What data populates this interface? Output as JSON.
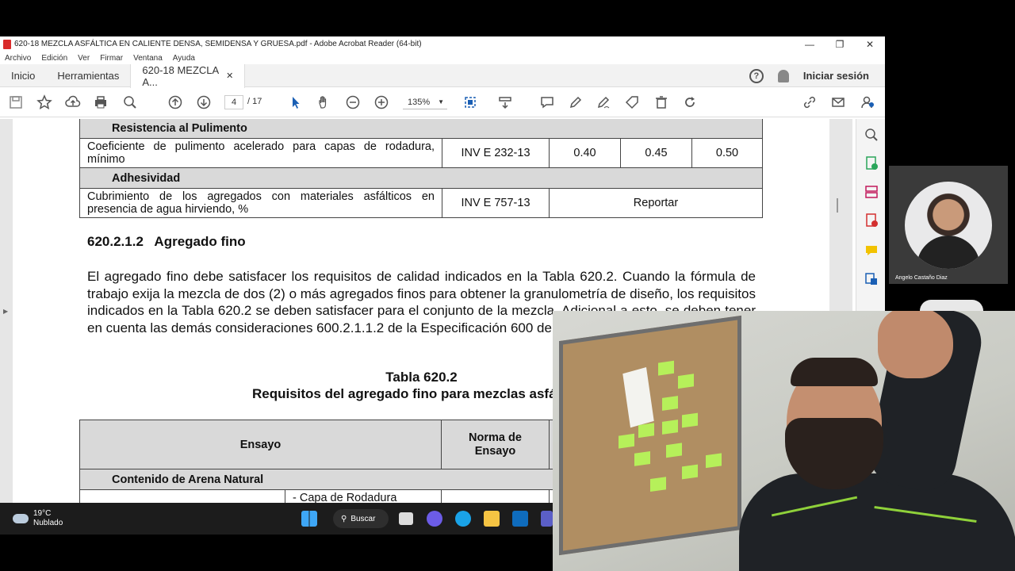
{
  "window": {
    "title": "620-18 MEZCLA ASFÁLTICA EN CALIENTE DENSA, SEMIDENSA Y GRUESA.pdf - Adobe Acrobat Reader (64-bit)",
    "minimize": "—",
    "maximize": "❐",
    "close": "✕"
  },
  "menu": [
    "Archivo",
    "Edición",
    "Ver",
    "Firmar",
    "Ventana",
    "Ayuda"
  ],
  "tabs": {
    "home": "Inicio",
    "tools": "Herramientas",
    "doc": "620-18 MEZCLA A...",
    "doc_close": "✕",
    "help": "?",
    "signin": "Iniciar sesión"
  },
  "toolbar": {
    "page_current": "4",
    "page_total": "/ 17",
    "zoom": "135%"
  },
  "table1": {
    "section1": "Resistencia al Pulimento",
    "row1": {
      "ensayo": "Coeficiente de pulimento acelerado para capas de rodadura, mínimo",
      "norma": "INV E 232-13",
      "v1": "0.40",
      "v2": "0.45",
      "v3": "0.50"
    },
    "section2": "Adhesividad",
    "row2": {
      "ensayo": "Cubrimiento de los agregados con materiales asfálticos en presencia de agua hirviendo, %",
      "norma": "INV E 757-13",
      "value": "Reportar"
    }
  },
  "heading": "620.2.1.2   Agregado fino",
  "paragraph": "El agregado fino debe satisfacer los requisitos de calidad indicados en la Tabla 620.2. Cuando la fórmula de trabajo exija la mezcla de dos (2) o más agregados finos para obtener la granulometría de diseño, los requisitos indicados en la Tabla 620.2 se deben satisfacer para el conjunto de la mezcla. Adicional a esto, se deben tener en cuenta las demás consideraciones 600.2.1.1.2 de la Especificación 600 de estas especificaciones.",
  "table_caption": {
    "line1": "Tabla 620.2",
    "line2": "Requisitos del agregado fino para mezclas asfálticas"
  },
  "table2": {
    "h_ensayo": "Ensayo",
    "h_norma": "Norma de Ensayo",
    "section": "Contenido de Arena Natural",
    "sub": "- Capa de Rodadura"
  },
  "taskbar": {
    "temp": "19°C",
    "weather": "Nublado",
    "search": "Buscar"
  },
  "participant": {
    "name": "Angelo Castaño Diaz"
  }
}
